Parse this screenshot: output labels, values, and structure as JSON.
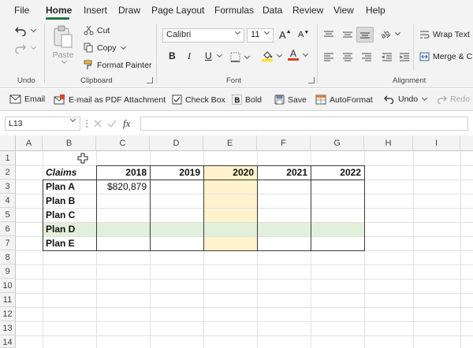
{
  "menu": {
    "tabs": [
      "File",
      "Home",
      "Insert",
      "Draw",
      "Page Layout",
      "Formulas",
      "Data",
      "Review",
      "View",
      "Help"
    ],
    "active": "Home"
  },
  "ribbon": {
    "undo_group_label": "Undo",
    "clipboard": {
      "label": "Clipboard",
      "paste": "Paste",
      "cut": "Cut",
      "copy": "Copy",
      "format_painter": "Format Painter"
    },
    "font": {
      "label": "Font",
      "name": "Calibri",
      "size": "11",
      "bold_glyph": "B",
      "italic_glyph": "I",
      "underline_glyph": "U",
      "increase_glyph": "A",
      "decrease_glyph": "A",
      "font_color_glyph": "A"
    },
    "alignment": {
      "label": "Alignment",
      "wrap_text": "Wrap Text",
      "merge": "Merge & C"
    }
  },
  "quick_access": {
    "email": "Email",
    "email_pdf": "E-mail as PDF Attachment",
    "check_box": "Check Box",
    "bold": "Bold",
    "save": "Save",
    "autoformat": "AutoFormat",
    "undo": "Undo",
    "redo": "Redo"
  },
  "formula_bar": {
    "name_box": "L13",
    "fx": "fx",
    "formula": ""
  },
  "sheet": {
    "columns": [
      "A",
      "B",
      "C",
      "D",
      "E",
      "F",
      "G",
      "H",
      "I"
    ],
    "rows": [
      "1",
      "2",
      "3",
      "4",
      "5",
      "6",
      "7",
      "8",
      "9",
      "10",
      "11",
      "12",
      "13",
      "14"
    ],
    "header_label": "Claims",
    "years": [
      "2018",
      "2019",
      "2020",
      "2021",
      "2022"
    ],
    "plans": [
      "Plan A",
      "Plan B",
      "Plan C",
      "Plan D",
      "Plan E"
    ],
    "c3_value": "$820,879"
  },
  "colors": {
    "accent": "#217346",
    "row_highlight": "#e2efda",
    "col_highlight": "#fff2cc",
    "font_color_bar": "#e03c2a",
    "fill_color_bar": "#ffe600"
  }
}
